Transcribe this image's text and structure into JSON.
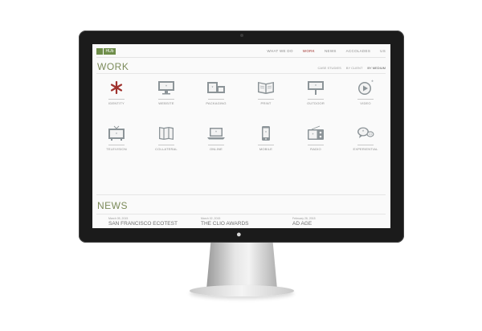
{
  "brand": {
    "logo_text": "HUb"
  },
  "nav": [
    "WHAT WE DO",
    "WORK",
    "NEWS",
    "ACCOLADES",
    "US"
  ],
  "nav_active_index": 1,
  "work": {
    "title": "WORK",
    "filters": [
      "CASE STUDIES",
      "BY CLIENT",
      "BY MEDIUM"
    ],
    "filter_active_index": 2,
    "items": [
      {
        "label": "IDENTITY",
        "icon": "asterisk-icon"
      },
      {
        "label": "WEBSITE",
        "icon": "monitor-icon"
      },
      {
        "label": "PACKAGING",
        "icon": "boxes-icon"
      },
      {
        "label": "PRINT",
        "icon": "open-book-icon"
      },
      {
        "label": "OUTDOOR",
        "icon": "billboard-icon"
      },
      {
        "label": "VIDEO",
        "icon": "play-icon"
      },
      {
        "label": "TELEVISION",
        "icon": "tv-icon"
      },
      {
        "label": "COLLATERAL",
        "icon": "brochure-icon"
      },
      {
        "label": "ONLINE",
        "icon": "laptop-icon"
      },
      {
        "label": "MOBILE",
        "icon": "phone-icon"
      },
      {
        "label": "RADIO",
        "icon": "radio-icon"
      },
      {
        "label": "EXPERIENTIAL",
        "icon": "chat-bubbles-icon"
      }
    ]
  },
  "news": {
    "title": "NEWS",
    "items": [
      {
        "date": "March 05, 2015",
        "title": "SAN FRANCISCO ECOTEST"
      },
      {
        "date": "March 02, 2015",
        "title": "THE CLIO AWARDS"
      },
      {
        "date": "February 26, 2015",
        "title": "AD AGE"
      }
    ]
  },
  "colors": {
    "accent_red": "#a0322e",
    "accent_green": "#7c8b5a",
    "icon_gray": "#8c9498"
  }
}
